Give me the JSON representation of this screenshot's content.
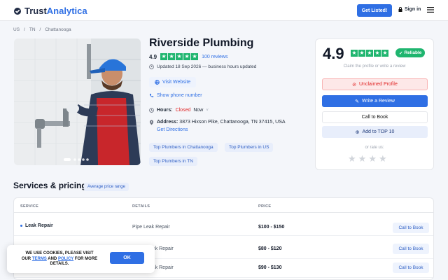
{
  "header": {
    "logo_part1": "Trust",
    "logo_part2": "Analytica",
    "get_listed": "Get Listed!",
    "sign_in": "Sign in"
  },
  "breadcrumb": [
    "US",
    "TN",
    "Chattanooga"
  ],
  "business": {
    "name": "Riverside Plumbing",
    "rating": "4.9",
    "stars": 5,
    "reviews": "100 reviews",
    "updated": "Updated 18 Sep 2026 — business hours updated",
    "visit_website": "Visit Website",
    "show_phone": "Show phone number",
    "hours_label": "Hours:",
    "hours_status": "Closed",
    "hours_now": "Now",
    "address_label": "Address:",
    "address": "3873 Hixson Pike, Chattanooga, TN 37415, USA",
    "get_directions": "Get Directions",
    "tags": [
      "Top Plumbers in Chattanooga",
      "Top Plumbers in US",
      "Top Plumbers in TN"
    ]
  },
  "card": {
    "score": "4.9",
    "reliable": "Reliable",
    "claim_text": "Claim the profile or write a review",
    "unclaimed": "Unclaimed Profile",
    "write_review": "Write a Review",
    "call_to_book": "Call to Book",
    "add_top10": "Add to TOP 10",
    "or_rate": "or rate us:"
  },
  "services": {
    "title": "Services & pricing",
    "badge": "Average price range",
    "headers": [
      "SERVICE",
      "DETAILS",
      "PRICE"
    ],
    "rows": [
      {
        "service": "Leak Repair",
        "details": "Pipe Leak Repair",
        "price": "$100 - $150",
        "action": "Call to Book"
      },
      {
        "service": "",
        "details": "Leak Repair",
        "price": "$80 - $120",
        "action": "Call to Book"
      },
      {
        "service": "",
        "details": "Leak Repair",
        "price": "$90 - $130",
        "action": "Call to Book"
      }
    ]
  },
  "cookie": {
    "line1": "WE USE COOKIES, PLEASE VISIT",
    "our": "OUR",
    "terms": "TERMS",
    "and": "AND",
    "policy": "POLICY",
    "rest": "FOR MORE DETAILS.",
    "ok": "OK"
  },
  "colors": {
    "accent": "#2f6fe4",
    "star_green": "#1fb56f",
    "closed_red": "#e02424"
  }
}
